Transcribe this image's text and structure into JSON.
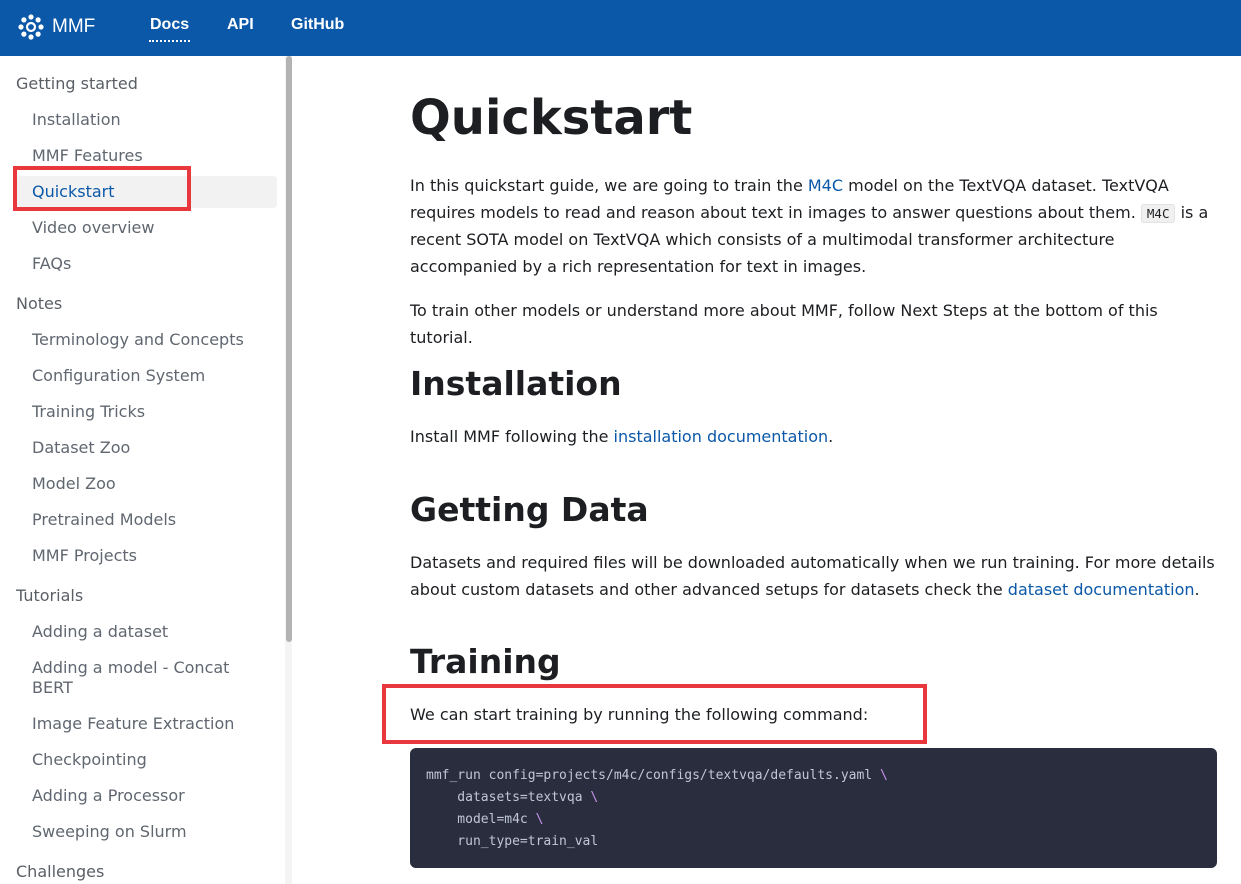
{
  "navbar": {
    "brand": "MMF",
    "links": [
      "Docs",
      "API",
      "GitHub"
    ],
    "color": "#0b58a8"
  },
  "sidebar": {
    "sections": [
      {
        "category": "Getting started",
        "items": [
          "Installation",
          "MMF Features",
          "Quickstart",
          "Video overview",
          "FAQs"
        ]
      },
      {
        "category": "Notes",
        "items": [
          "Terminology and Concepts",
          "Configuration System",
          "Training Tricks",
          "Dataset Zoo",
          "Model Zoo",
          "Pretrained Models",
          "MMF Projects"
        ]
      },
      {
        "category": "Tutorials",
        "items": [
          "Adding a dataset",
          "Adding a model - Concat BERT",
          "Image Feature Extraction",
          "Checkpointing",
          "Adding a Processor",
          "Sweeping on Slurm"
        ]
      },
      {
        "category": "Challenges",
        "items": []
      }
    ],
    "active_item": "Quickstart"
  },
  "main": {
    "title": "Quickstart",
    "intro": {
      "t1": "In this quickstart guide, we are going to train the ",
      "link_m4c": "M4C",
      "t2": " model on the TextVQA dataset. TextVQA requires models to read and reason about text in images to answer questions about them. ",
      "code_m4c": "M4C",
      "t3": " is a recent SOTA model on TextVQA which consists of a multimodal transformer architecture accompanied by a rich representation for text in images."
    },
    "next_steps_text": "To train other models or understand more about MMF, follow Next Steps at the bottom of this tutorial.",
    "installation": {
      "heading": "Installation",
      "t1": "Install MMF following the ",
      "link": "installation documentation",
      "t2": "."
    },
    "getting_data": {
      "heading": "Getting Data",
      "t1": "Datasets and required files will be downloaded automatically when we run training. For more details about custom datasets and other advanced setups for datasets check the ",
      "link": "dataset documentation",
      "t2": "."
    },
    "training": {
      "heading": "Training",
      "text": "We can start training by running the following command:",
      "code_lines": [
        "mmf_run config=projects/m4c/configs/textvqa/defaults.yaml \\",
        "    datasets=textvqa \\",
        "    model=m4c \\",
        "    run_type=train_val"
      ]
    }
  },
  "colors": {
    "accent": "#0b58a8",
    "highlight": "#e8383d",
    "code_bg": "#292d3e"
  }
}
